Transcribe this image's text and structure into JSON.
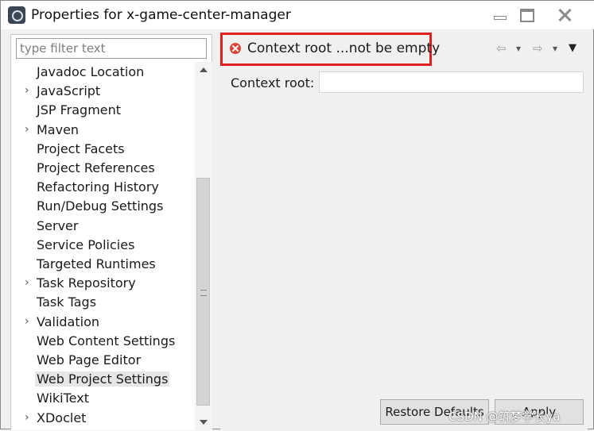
{
  "window": {
    "title": "Properties for x-game-center-manager"
  },
  "filter": {
    "placeholder": "type filter text"
  },
  "tree": {
    "items": [
      {
        "label": "Javadoc Location",
        "expandable": false,
        "selected": false
      },
      {
        "label": "JavaScript",
        "expandable": true,
        "selected": false
      },
      {
        "label": "JSP Fragment",
        "expandable": false,
        "selected": false
      },
      {
        "label": "Maven",
        "expandable": true,
        "selected": false
      },
      {
        "label": "Project Facets",
        "expandable": false,
        "selected": false
      },
      {
        "label": "Project References",
        "expandable": false,
        "selected": false
      },
      {
        "label": "Refactoring History",
        "expandable": false,
        "selected": false
      },
      {
        "label": "Run/Debug Settings",
        "expandable": false,
        "selected": false
      },
      {
        "label": "Server",
        "expandable": false,
        "selected": false
      },
      {
        "label": "Service Policies",
        "expandable": false,
        "selected": false
      },
      {
        "label": "Targeted Runtimes",
        "expandable": false,
        "selected": false
      },
      {
        "label": "Task Repository",
        "expandable": true,
        "selected": false
      },
      {
        "label": "Task Tags",
        "expandable": false,
        "selected": false
      },
      {
        "label": "Validation",
        "expandable": true,
        "selected": false
      },
      {
        "label": "Web Content Settings",
        "expandable": false,
        "selected": false
      },
      {
        "label": "Web Page Editor",
        "expandable": false,
        "selected": false
      },
      {
        "label": "Web Project Settings",
        "expandable": false,
        "selected": true
      },
      {
        "label": "WikiText",
        "expandable": false,
        "selected": false
      },
      {
        "label": "XDoclet",
        "expandable": true,
        "selected": false
      }
    ]
  },
  "page": {
    "error_message": "Context root ...not be empty",
    "error_icon": "error-icon",
    "context_root_label": "Context root:",
    "context_root_value": ""
  },
  "buttons": {
    "restore_defaults": "Restore Defaults",
    "apply": "Apply"
  },
  "icons": {
    "back": "⇦",
    "forward": "⇨",
    "dropdown": "▾",
    "view_menu": "▼",
    "chevron": "›"
  },
  "watermark": "CSDN @筑梦学长ya",
  "colors": {
    "error_highlight": "#e02020",
    "selected_item": "#e6e6e6"
  }
}
